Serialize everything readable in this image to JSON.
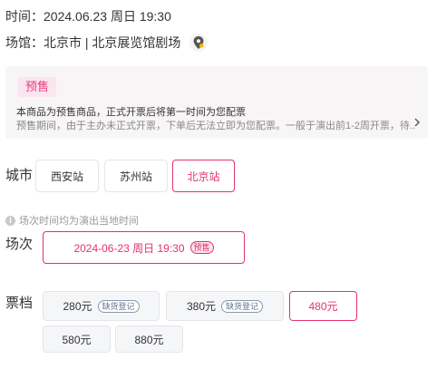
{
  "info": {
    "time_label": "时间：",
    "time_value": "2024.06.23 周日 19:30",
    "venue_label": "场馆：",
    "venue_value": "北京市 | 北京展览馆剧场"
  },
  "notice": {
    "tag": "预售",
    "title": "本商品为预售商品，正式开票后将第一时间为您配票",
    "desc": "预售期间，由于主办未正式开票，下单后无法立即为您配票。一般于演出前1-2周开票，待..."
  },
  "city": {
    "label": "城市",
    "options": [
      "西安站",
      "苏州站",
      "北京站"
    ],
    "selected": "北京站"
  },
  "session": {
    "hint": "场次时间均为演出当地时间",
    "label": "场次",
    "options": [
      {
        "text": "2024-06-23 周日 19:30",
        "badge": "预售"
      }
    ]
  },
  "tier": {
    "label": "票档",
    "options": [
      {
        "price": "280元",
        "badge": "缺货登记"
      },
      {
        "price": "380元",
        "badge": "缺货登记"
      },
      {
        "price": "480元",
        "badge": ""
      },
      {
        "price": "580元",
        "badge": ""
      },
      {
        "price": "880元",
        "badge": ""
      }
    ],
    "selected": "480元"
  },
  "colors": {
    "accent": "#e3336f",
    "presale_bg": "#fbe5ee",
    "notice_bg": "#f8f5f7"
  }
}
